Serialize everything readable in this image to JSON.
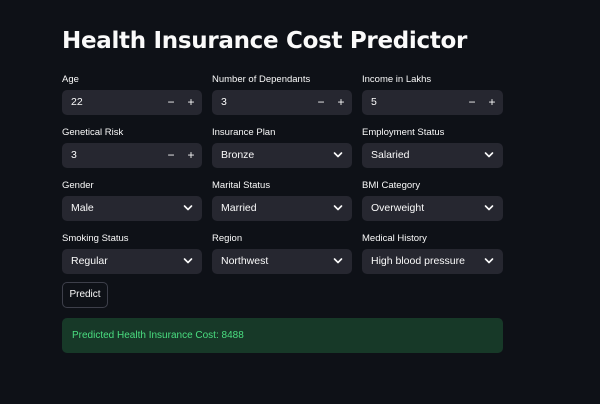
{
  "page": {
    "title": "Health Insurance Cost Predictor"
  },
  "fields": {
    "age": {
      "label": "Age",
      "value": "22"
    },
    "dependants": {
      "label": "Number of Dependants",
      "value": "3"
    },
    "income": {
      "label": "Income in Lakhs",
      "value": "5"
    },
    "genetical_risk": {
      "label": "Genetical Risk",
      "value": "3"
    },
    "insurance_plan": {
      "label": "Insurance Plan",
      "value": "Bronze"
    },
    "employment_status": {
      "label": "Employment Status",
      "value": "Salaried"
    },
    "gender": {
      "label": "Gender",
      "value": "Male"
    },
    "marital_status": {
      "label": "Marital Status",
      "value": "Married"
    },
    "bmi_category": {
      "label": "BMI Category",
      "value": "Overweight"
    },
    "smoking_status": {
      "label": "Smoking Status",
      "value": "Regular"
    },
    "region": {
      "label": "Region",
      "value": "Northwest"
    },
    "medical_history": {
      "label": "Medical History",
      "value": "High blood pressure"
    }
  },
  "stepper": {
    "minus": "−",
    "plus": "+"
  },
  "icons": {
    "dropdown": "chevron-down-icon"
  },
  "actions": {
    "predict_label": "Predict"
  },
  "result": {
    "text": "Predicted Health Insurance Cost: 8488"
  },
  "colors": {
    "background": "#0e1117",
    "input": "#262730",
    "success_bg": "#173928",
    "success_text": "#4ade80"
  }
}
